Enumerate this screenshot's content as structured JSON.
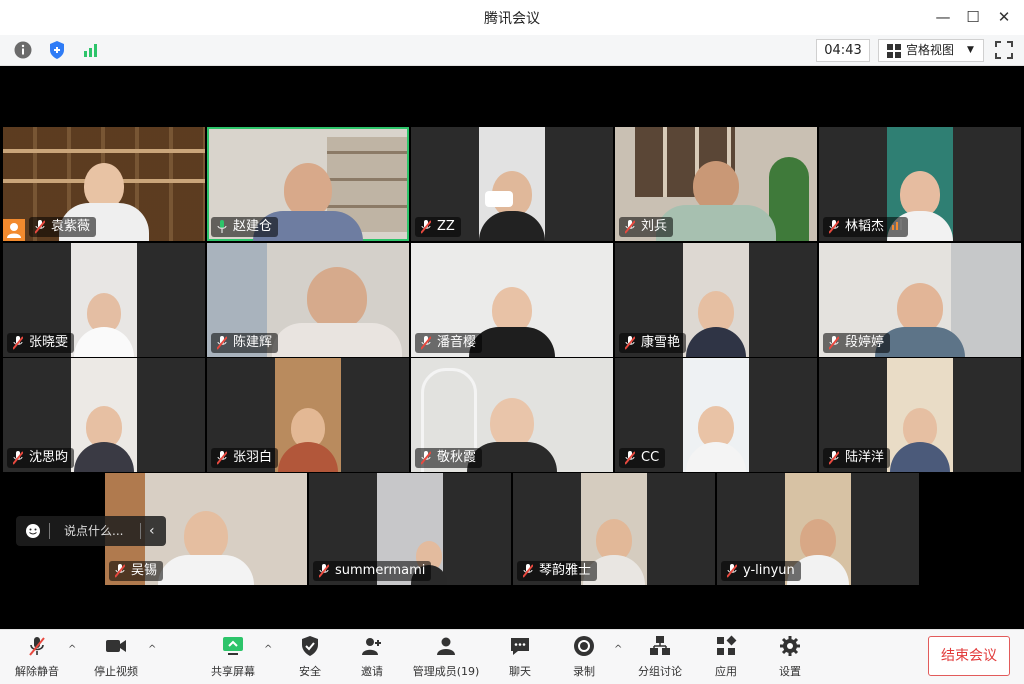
{
  "window": {
    "title": "腾讯会议",
    "minimize_icon": "minimize-icon",
    "maximize_icon": "maximize-icon",
    "close_icon": "close-icon"
  },
  "toolbar": {
    "timer": "04:43",
    "view_label": "宫格视图"
  },
  "chat": {
    "placeholder": "说点什么..."
  },
  "participants": [
    {
      "name": "袁紫薇",
      "mic": "muted",
      "host_badge": true
    },
    {
      "name": "赵建仓",
      "mic": "active",
      "speaking": true
    },
    {
      "name": "ZZ",
      "mic": "muted"
    },
    {
      "name": "刘兵",
      "mic": "muted"
    },
    {
      "name": "林韬杰",
      "mic": "muted",
      "signal": true
    },
    {
      "name": "张晓雯",
      "mic": "muted"
    },
    {
      "name": "陈建辉",
      "mic": "muted"
    },
    {
      "name": "潘音樱",
      "mic": "muted"
    },
    {
      "name": "康雪艳",
      "mic": "muted"
    },
    {
      "name": "段婷婷",
      "mic": "muted"
    },
    {
      "name": "沈思昀",
      "mic": "muted"
    },
    {
      "name": "张羽白",
      "mic": "muted"
    },
    {
      "name": "敬秋霞",
      "mic": "muted"
    },
    {
      "name": "CC",
      "mic": "muted"
    },
    {
      "name": "陆洋洋",
      "mic": "muted"
    },
    {
      "name": "吴锡",
      "mic": "muted"
    },
    {
      "name": "summermami",
      "mic": "muted"
    },
    {
      "name": "琴韵雅士",
      "mic": "muted"
    },
    {
      "name": "y-linyun",
      "mic": "muted"
    }
  ],
  "bottom_bar": {
    "unmute": "解除静音",
    "stop_video": "停止视频",
    "share_screen": "共享屏幕",
    "security": "安全",
    "invite": "邀请",
    "manage_members": "管理成员(19)",
    "chat": "聊天",
    "record": "录制",
    "breakout": "分组讨论",
    "apps": "应用",
    "settings": "设置",
    "end_meeting": "结束会议"
  },
  "colors": {
    "accent_green": "#2dc46a",
    "end_red": "#e23b3b",
    "muted_red": "#e8493f"
  }
}
